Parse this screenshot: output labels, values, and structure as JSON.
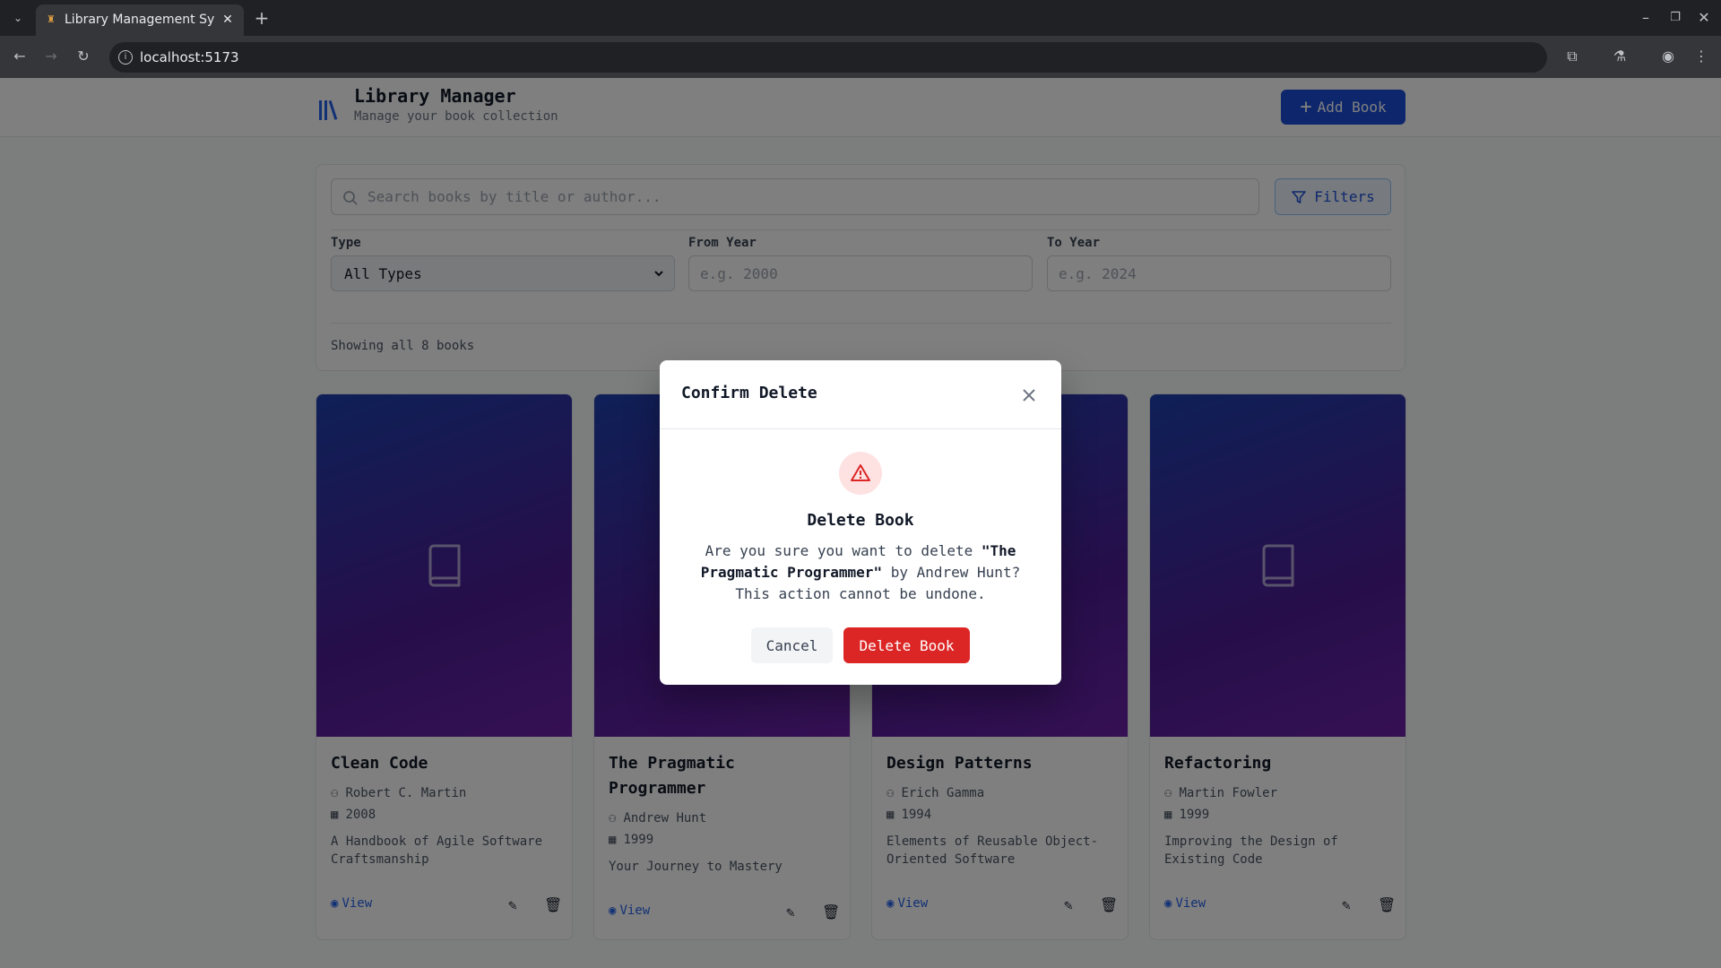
{
  "browser": {
    "tab_title": "Library Management Sy",
    "url": "localhost:5173"
  },
  "header": {
    "title": "Library Manager",
    "subtitle": "Manage your book collection",
    "add_button": "Add Book"
  },
  "filters": {
    "search_placeholder": "Search books by title or author...",
    "filters_button": "Filters",
    "type_label": "Type",
    "type_value": "All Types",
    "from_label": "From Year",
    "from_placeholder": "e.g. 2000",
    "to_label": "To Year",
    "to_placeholder": "e.g. 2024",
    "showing": "Showing all 8 books"
  },
  "books": [
    {
      "title": "Clean Code",
      "author": "Robert C. Martin",
      "year": "2008",
      "description": "A Handbook of Agile Software Craftsmanship",
      "view": "View"
    },
    {
      "title": "The Pragmatic Programmer",
      "author": "Andrew Hunt",
      "year": "1999",
      "description": "Your Journey to Mastery",
      "view": "View"
    },
    {
      "title": "Design Patterns",
      "author": "Erich Gamma",
      "year": "1994",
      "description": "Elements of Reusable Object-Oriented Software",
      "view": "View"
    },
    {
      "title": "Refactoring",
      "author": "Martin Fowler",
      "year": "1999",
      "description": "Improving the Design of Existing Code",
      "view": "View"
    }
  ],
  "modal": {
    "title": "Confirm Delete",
    "heading": "Delete Book",
    "text_before": "Are you sure you want to delete ",
    "book_quoted": "\"The Pragmatic Programmer\"",
    "text_after": " by Andrew Hunt? This action cannot be undone.",
    "cancel": "Cancel",
    "confirm": "Delete Book"
  },
  "colors": {
    "primary": "#1d4ed8",
    "danger": "#dc2626",
    "cover_gradient_start": "#1e40af",
    "cover_gradient_end": "#6b21a8"
  }
}
